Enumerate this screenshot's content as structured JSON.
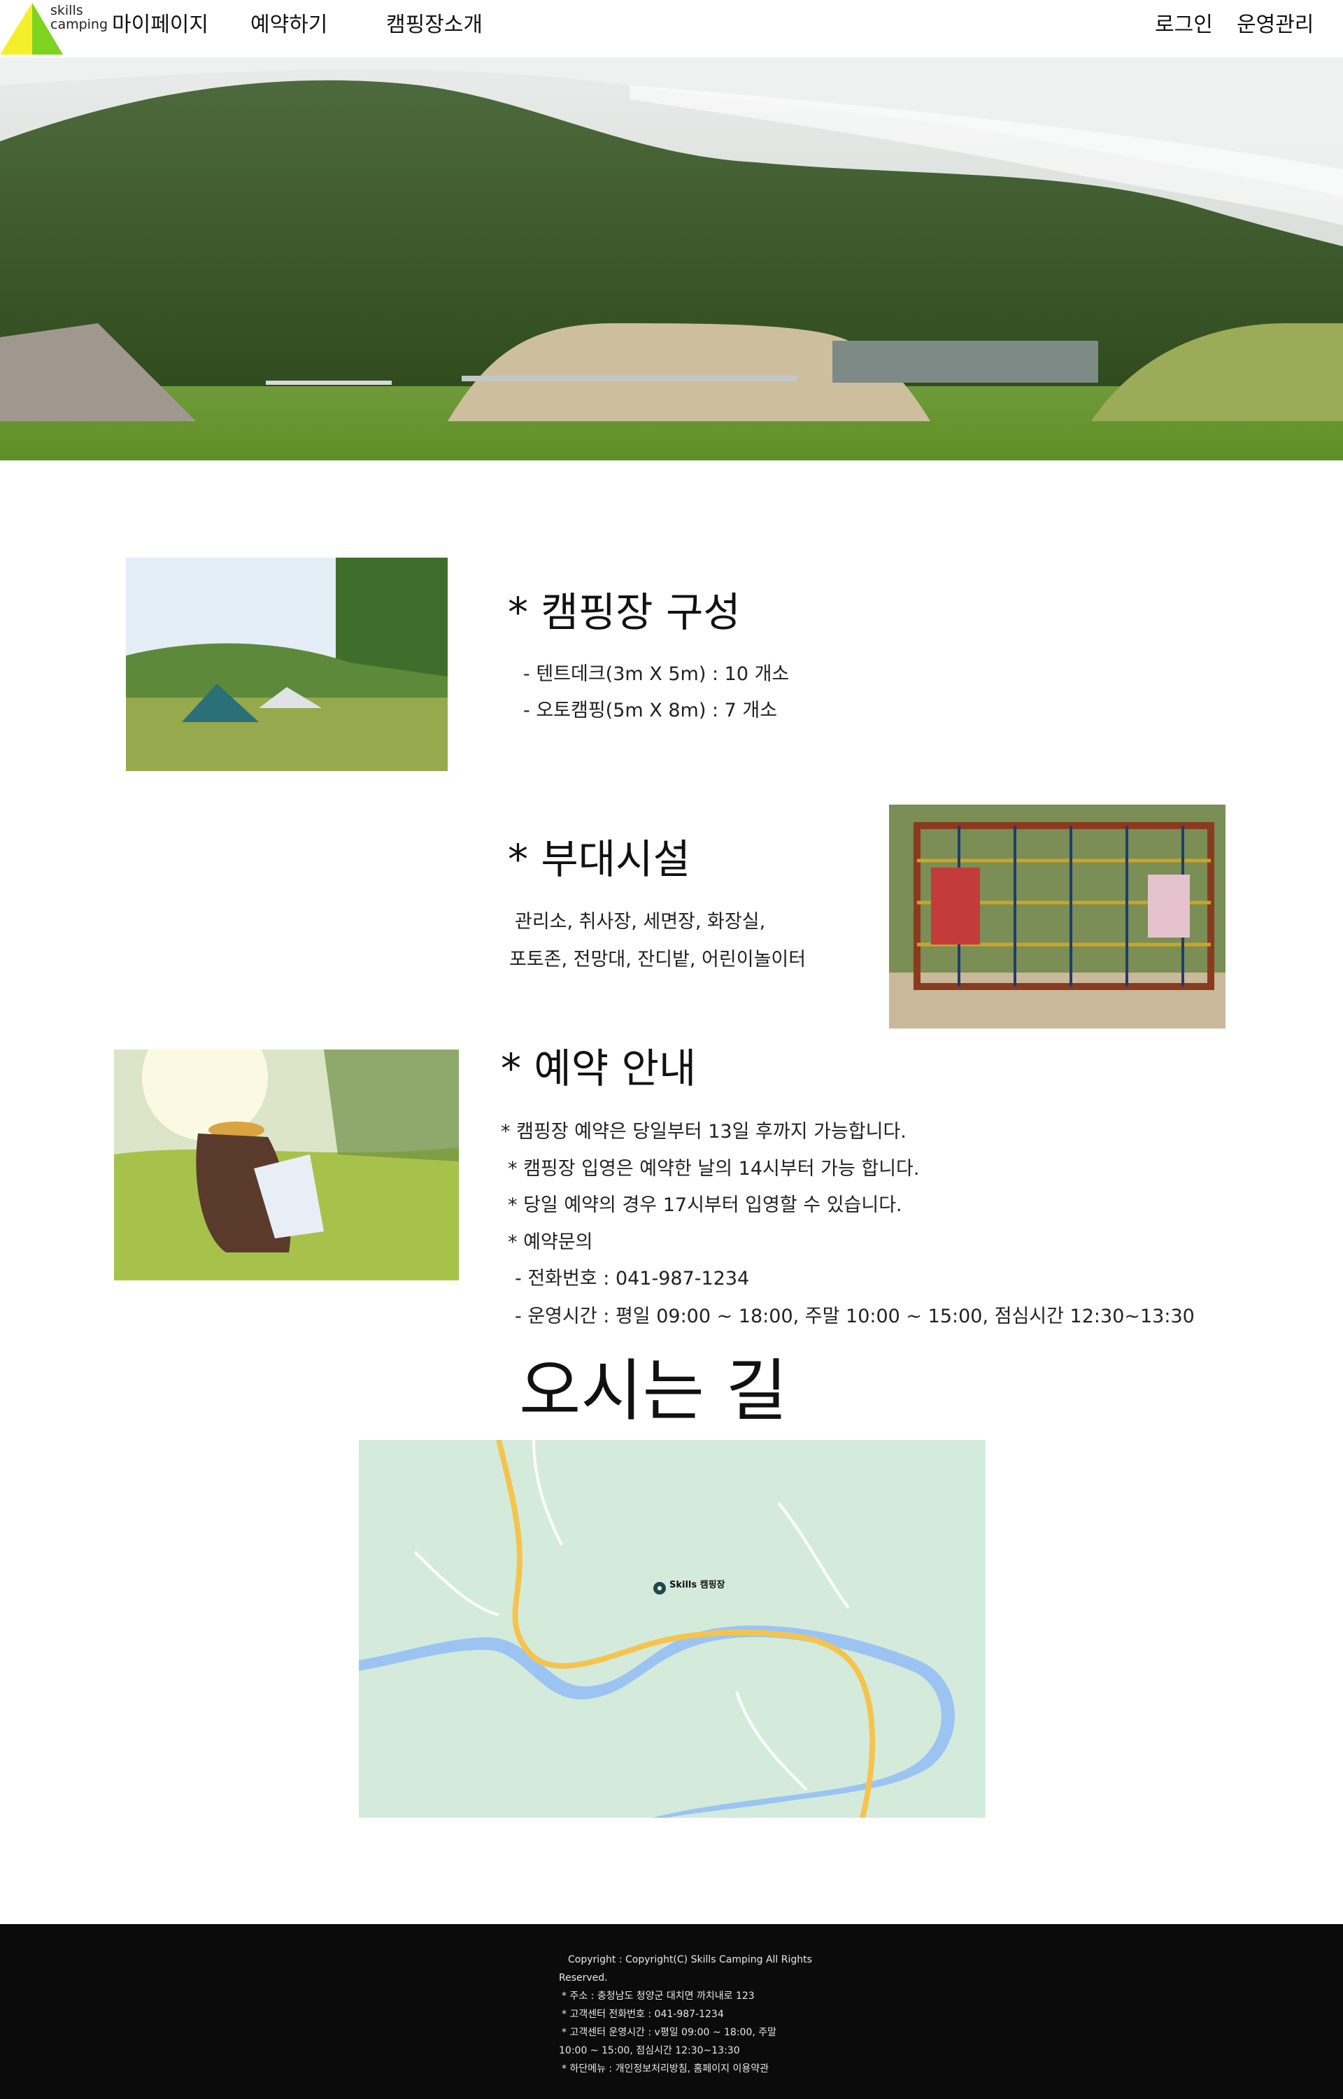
{
  "logo": {
    "line1": "skills",
    "line2": "camping"
  },
  "nav": {
    "mypage": "마이페이지",
    "reserve": "예약하기",
    "intro": "캠핑장소개",
    "login": "로그인",
    "admin": "운영관리"
  },
  "sections": {
    "composition": {
      "title": "* 캠핑장 구성",
      "lines": [
        "- 텐트데크(3m X 5m) : 10 개소",
        "- 오토캠핑(5m X 8m) : 7 개소"
      ]
    },
    "facilities": {
      "title": "* 부대시설",
      "lines": [
        "관리소, 취사장, 세면장, 화장실,",
        "포토존, 전망대, 잔디밭, 어린이놀이터"
      ]
    },
    "reservation": {
      "title": "* 예약 안내",
      "lines": [
        "* 캠핑장 예약은 당일부터 13일 후까지 가능합니다.",
        "* 캠핑장 입영은 예약한 날의 14시부터 가능 합니다.",
        "* 당일 예약의 경우 17시부터 입영할 수 있습니다.",
        "* 예약문의",
        "- 전화번호 : 041-987-1234",
        "- 운영시간 : 평일 09:00 ~ 18:00, 주말 10:00 ~ 15:00, 점심시간 12:30~13:30"
      ]
    }
  },
  "map": {
    "title": "오시는 길",
    "marker_label": "Skills 캠핑장"
  },
  "footer": {
    "lines": [
      "Copyright : Copyright(C) Skills Camping All Rights",
      "Reserved.",
      "* 주소 : 충청남도 청양군 대치면 까치내로 123",
      "* 고객센터 전화번호 : 041-987-1234",
      "* 고객센터 운영시간 : v평일 09:00 ~ 18:00, 주말",
      "10:00 ~ 15:00, 점심시간 12:30~13:30",
      "* 하단메뉴 : 개인정보처리방침, 홈페이지 이용약관"
    ]
  },
  "colors": {
    "logo_yellow": "#f5ef2a",
    "logo_green": "#7ed321",
    "footer_bg": "#0b0b0b",
    "map_bg": "#d4ebdc",
    "map_river": "#9cc4f3",
    "map_road": "#f5c44e"
  }
}
